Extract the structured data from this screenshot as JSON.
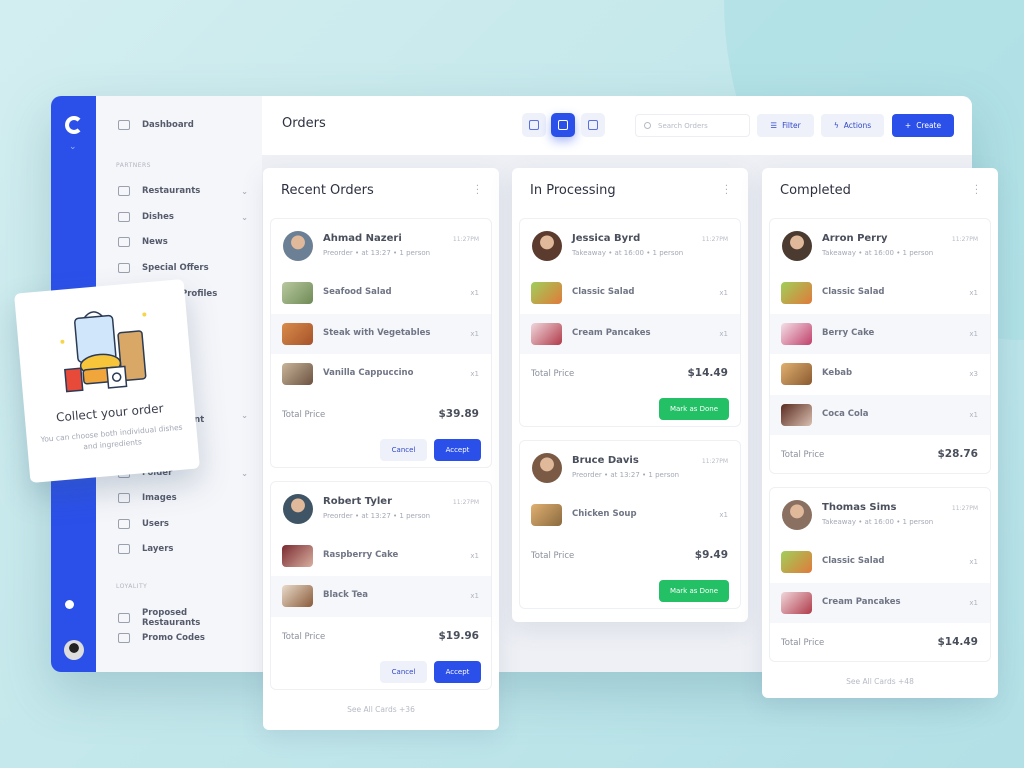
{
  "app": {
    "page_title": "Orders"
  },
  "sidebar": {
    "top_item": {
      "label": "Dashboard",
      "icon": "dashboard-icon"
    },
    "sections": [
      {
        "title": "PARTNERS",
        "items": [
          {
            "label": "Restaurants",
            "icon": "home-icon",
            "chevron": true
          },
          {
            "label": "Dishes",
            "icon": "cutlery-icon",
            "chevron": true
          },
          {
            "label": "News",
            "icon": "news-icon"
          },
          {
            "label": "Special Offers",
            "icon": "layers-icon"
          },
          {
            "label": "Partner Profiles",
            "icon": "profile-icon"
          }
        ]
      },
      {
        "title": "",
        "items": [
          {
            "label": "Content Management",
            "icon": "content-icon",
            "chevron": true
          },
          {
            "label": "Folder",
            "icon": "folder-icon",
            "chevron": true
          },
          {
            "label": "Images",
            "icon": "image-icon"
          },
          {
            "label": "Users",
            "icon": "users-icon"
          },
          {
            "label": "Layers",
            "icon": "layers-icon"
          }
        ]
      },
      {
        "title": "LOYALITY",
        "items": [
          {
            "label": "Proposed Restaurants",
            "icon": "folder-open-icon"
          },
          {
            "label": "Promo Codes",
            "icon": "promo-icon"
          }
        ]
      }
    ]
  },
  "toolbar": {
    "search_placeholder": "Search Orders",
    "filter_label": "Filter",
    "actions_label": "Actions",
    "create_label": "Create",
    "view_modes": [
      "table-view",
      "board-view",
      "cards-view"
    ],
    "active_view": "board-view"
  },
  "promo": {
    "title": "Collect your order",
    "subtitle": "You can choose both individual dishes and ingredients"
  },
  "colors": {
    "primary": "#2b50ea",
    "success": "#23c065"
  },
  "columns": [
    {
      "title": "Recent Orders",
      "see_all": "See All Cards +36",
      "orders": [
        {
          "name": "Ahmad Nazeri",
          "time": "11:27PM",
          "meta": "Preorder  •  at 13:27  •  1 person",
          "items": [
            {
              "name": "Seafood Salad",
              "qty": "x1"
            },
            {
              "name": "Steak with Vegetables",
              "qty": "x1"
            },
            {
              "name": "Vanilla Cappuccino",
              "qty": "x1"
            }
          ],
          "total_label": "Total Price",
          "total": "$39.89",
          "actions": [
            "Cancel",
            "Accept"
          ]
        },
        {
          "name": "Robert Tyler",
          "time": "11:27PM",
          "meta": "Preorder  •  at 13:27  •  1 person",
          "items": [
            {
              "name": "Raspberry Cake",
              "qty": "x1"
            },
            {
              "name": "Black Tea",
              "qty": "x1"
            }
          ],
          "total_label": "Total Price",
          "total": "$19.96",
          "actions": [
            "Cancel",
            "Accept"
          ]
        }
      ]
    },
    {
      "title": "In Processing",
      "see_all": "",
      "orders": [
        {
          "name": "Jessica Byrd",
          "time": "11:27PM",
          "meta": "Takeaway  •  at 16:00  •  1 person",
          "items": [
            {
              "name": "Classic Salad",
              "qty": "x1"
            },
            {
              "name": "Cream Pancakes",
              "qty": "x1"
            }
          ],
          "total_label": "Total Price",
          "total": "$14.49",
          "actions": [
            "Mark as Done"
          ]
        },
        {
          "name": "Bruce Davis",
          "time": "11:27PM",
          "meta": "Preorder  •  at 13:27  •  1 person",
          "items": [
            {
              "name": "Chicken Soup",
              "qty": "x1"
            }
          ],
          "total_label": "Total Price",
          "total": "$9.49",
          "actions": [
            "Mark as Done"
          ]
        }
      ]
    },
    {
      "title": "Completed",
      "see_all": "See All Cards +48",
      "orders": [
        {
          "name": "Arron Perry",
          "time": "11:27PM",
          "meta": "Takeaway  •  at 16:00  •  1 person",
          "items": [
            {
              "name": "Classic Salad",
              "qty": "x1"
            },
            {
              "name": "Berry Cake",
              "qty": "x1"
            },
            {
              "name": "Kebab",
              "qty": "x3"
            },
            {
              "name": "Coca Cola",
              "qty": "x1"
            }
          ],
          "total_label": "Total Price",
          "total": "$28.76",
          "actions": []
        },
        {
          "name": "Thomas Sims",
          "time": "11:27PM",
          "meta": "Takeaway  •  at 16:00  •  1 person",
          "items": [
            {
              "name": "Classic Salad",
              "qty": "x1"
            },
            {
              "name": "Cream Pancakes",
              "qty": "x1"
            }
          ],
          "total_label": "Total Price",
          "total": "$14.49",
          "actions": []
        }
      ]
    }
  ]
}
